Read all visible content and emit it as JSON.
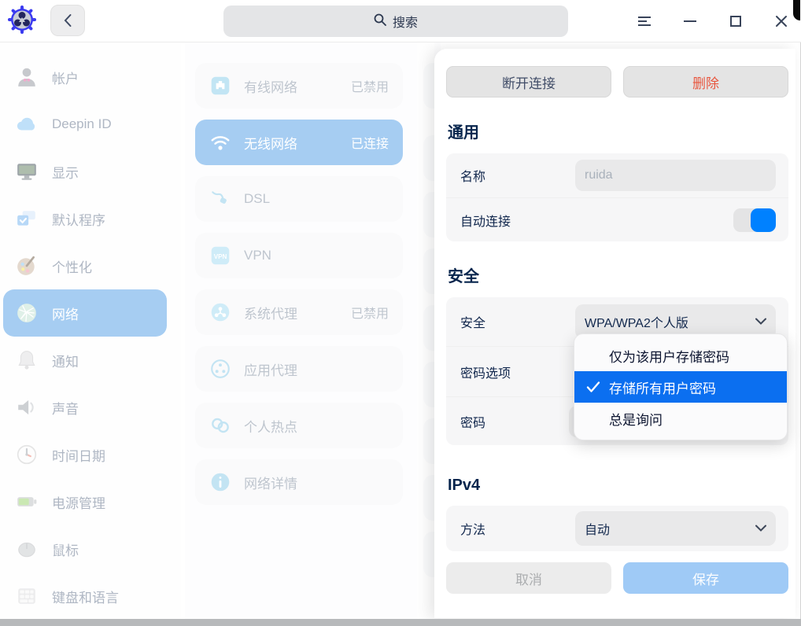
{
  "titlebar": {
    "search_placeholder": "搜索",
    "back_glyph": "‹"
  },
  "sidebar": {
    "items": [
      {
        "id": "accounts",
        "label": "帐户",
        "icon": "account-icon",
        "selected": false
      },
      {
        "id": "deepin-id",
        "label": "Deepin ID",
        "icon": "cloud-icon",
        "selected": false
      },
      {
        "id": "display",
        "label": "显示",
        "icon": "display-icon",
        "selected": false
      },
      {
        "id": "default-apps",
        "label": "默认程序",
        "icon": "default-apps-icon",
        "selected": false
      },
      {
        "id": "personalization",
        "label": "个性化",
        "icon": "palette-icon",
        "selected": false
      },
      {
        "id": "network",
        "label": "网络",
        "icon": "network-globe-icon",
        "selected": true
      },
      {
        "id": "notification",
        "label": "通知",
        "icon": "bell-icon",
        "selected": false
      },
      {
        "id": "sound",
        "label": "声音",
        "icon": "speaker-icon",
        "selected": false
      },
      {
        "id": "datetime",
        "label": "时间日期",
        "icon": "clock-icon",
        "selected": false
      },
      {
        "id": "power",
        "label": "电源管理",
        "icon": "battery-icon",
        "selected": false
      },
      {
        "id": "mouse",
        "label": "鼠标",
        "icon": "mouse-icon",
        "selected": false
      },
      {
        "id": "keyboard",
        "label": "键盘和语言",
        "icon": "keyboard-icon",
        "selected": false
      }
    ]
  },
  "network_list": {
    "items": [
      {
        "id": "wired",
        "label": "有线网络",
        "status": "已禁用",
        "icon": "ethernet-icon",
        "selected": false
      },
      {
        "id": "wireless",
        "label": "无线网络",
        "status": "已连接",
        "icon": "wifi-icon",
        "selected": true
      },
      {
        "id": "dsl",
        "label": "DSL",
        "status": "",
        "icon": "dsl-icon",
        "selected": false
      },
      {
        "id": "vpn",
        "label": "VPN",
        "status": "",
        "icon": "vpn-icon",
        "selected": false
      },
      {
        "id": "system-proxy",
        "label": "系统代理",
        "status": "已禁用",
        "icon": "system-proxy-icon",
        "selected": false
      },
      {
        "id": "app-proxy",
        "label": "应用代理",
        "status": "",
        "icon": "app-proxy-icon",
        "selected": false
      },
      {
        "id": "hotspot",
        "label": "个人热点",
        "status": "",
        "icon": "hotspot-icon",
        "selected": false
      },
      {
        "id": "net-details",
        "label": "网络详情",
        "status": "",
        "icon": "info-icon",
        "selected": false
      }
    ]
  },
  "detail": {
    "disconnect_label": "断开连接",
    "delete_label": "删除",
    "general": {
      "title": "通用",
      "name_label": "名称",
      "name_value": "ruida",
      "autoconnect_label": "自动连接",
      "autoconnect_on": true
    },
    "security": {
      "title": "安全",
      "security_label": "安全",
      "security_value": "WPA/WPA2个人版",
      "password_option_label": "密码选项",
      "password_label": "密码"
    },
    "ipv4": {
      "title": "IPv4",
      "method_label": "方法",
      "method_value": "自动"
    },
    "cancel_label": "取消",
    "save_label": "保存"
  },
  "password_menu": {
    "items": [
      {
        "label": "仅为该用户存储密码",
        "selected": false
      },
      {
        "label": "存储所有用户密码",
        "selected": true
      },
      {
        "label": "总是询问",
        "selected": false
      }
    ]
  },
  "colors": {
    "accent_blue": "#0081ff",
    "selection_blue": "#4d9be5",
    "menu_highlight": "#0b6ff0",
    "danger_red": "#e8573f",
    "save_button": "#9fcaf6"
  }
}
